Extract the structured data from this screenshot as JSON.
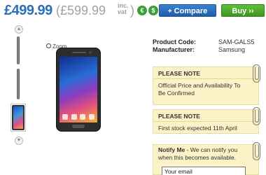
{
  "price": {
    "main": "£499.99",
    "alt_open": "(£599.99",
    "vat_line1": "inc.",
    "vat_line2": "vat",
    "alt_close": ")",
    "currency_icons": [
      "€",
      "$"
    ]
  },
  "actions": {
    "compare_icon": "+",
    "compare_label": "Compare",
    "buy_label": "Buy",
    "buy_icon": "››"
  },
  "gallery": {
    "scroll_up_icon": "▲",
    "scroll_down_icon": "▼",
    "zoom_label": "Zoom"
  },
  "product": {
    "code_label": "Product Code:",
    "code_value": "SAM-GALS5",
    "manufacturer_label": "Manufacturer:",
    "manufacturer_value": "Samsung"
  },
  "notes": [
    {
      "title": "PLEASE NOTE",
      "body": "Official Price and Availability To Be Confirmed"
    },
    {
      "title": "PLEASE NOTE",
      "body": "First stock expected 11th April"
    }
  ],
  "notify": {
    "bold": "Notify Me",
    "text": " - We can notify you when this becomes available.",
    "email_value": "Your email"
  },
  "colors": {
    "price_blue": "#2a6fb8",
    "compare_blue": "#1f5ea9",
    "buy_green": "#3e9520",
    "note_yellow": "#fbf2c8"
  }
}
